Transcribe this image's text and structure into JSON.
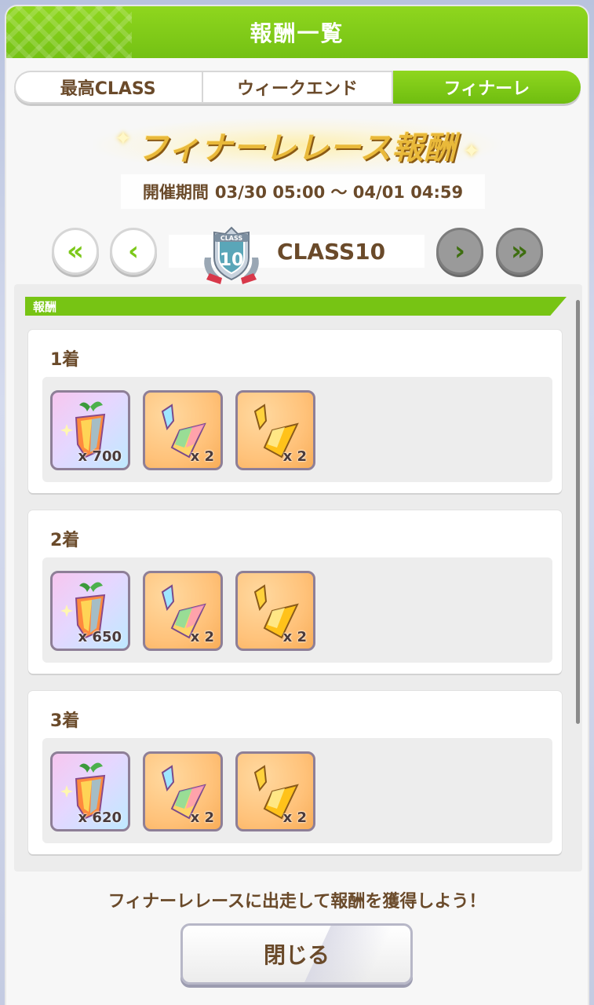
{
  "title": "報酬一覧",
  "tabs": [
    {
      "label": "最高CLASS",
      "active": false
    },
    {
      "label": "ウィークエンド",
      "active": false
    },
    {
      "label": "フィナーレ",
      "active": true
    }
  ],
  "banner": "フィナーレレース報酬",
  "period": {
    "label": "開催期間",
    "value": "03/30 05:00 〜 04/01 04:59"
  },
  "class_selector": {
    "label": "CLASS10",
    "emblem_number": "10",
    "emblem_text": "CLASS"
  },
  "section": {
    "title": "報酬"
  },
  "rewards": [
    {
      "rank": "1着",
      "items": [
        {
          "icon": "carrot-carat-icon",
          "count": "x 700"
        },
        {
          "icon": "rainbow-shard-icon",
          "count": "x 2"
        },
        {
          "icon": "gold-shard-icon",
          "count": "x 2"
        }
      ]
    },
    {
      "rank": "2着",
      "items": [
        {
          "icon": "carrot-carat-icon",
          "count": "x 650"
        },
        {
          "icon": "rainbow-shard-icon",
          "count": "x 2"
        },
        {
          "icon": "gold-shard-icon",
          "count": "x 2"
        }
      ]
    },
    {
      "rank": "3着",
      "items": [
        {
          "icon": "carrot-carat-icon",
          "count": "x 620"
        },
        {
          "icon": "rainbow-shard-icon",
          "count": "x 2"
        },
        {
          "icon": "gold-shard-icon",
          "count": "x 2"
        }
      ]
    }
  ],
  "message": "フィナーレレースに出走して報酬を獲得しよう！",
  "close_label": "閉じる",
  "colors": {
    "accent": "#77c414",
    "text": "#6a4a2a"
  }
}
